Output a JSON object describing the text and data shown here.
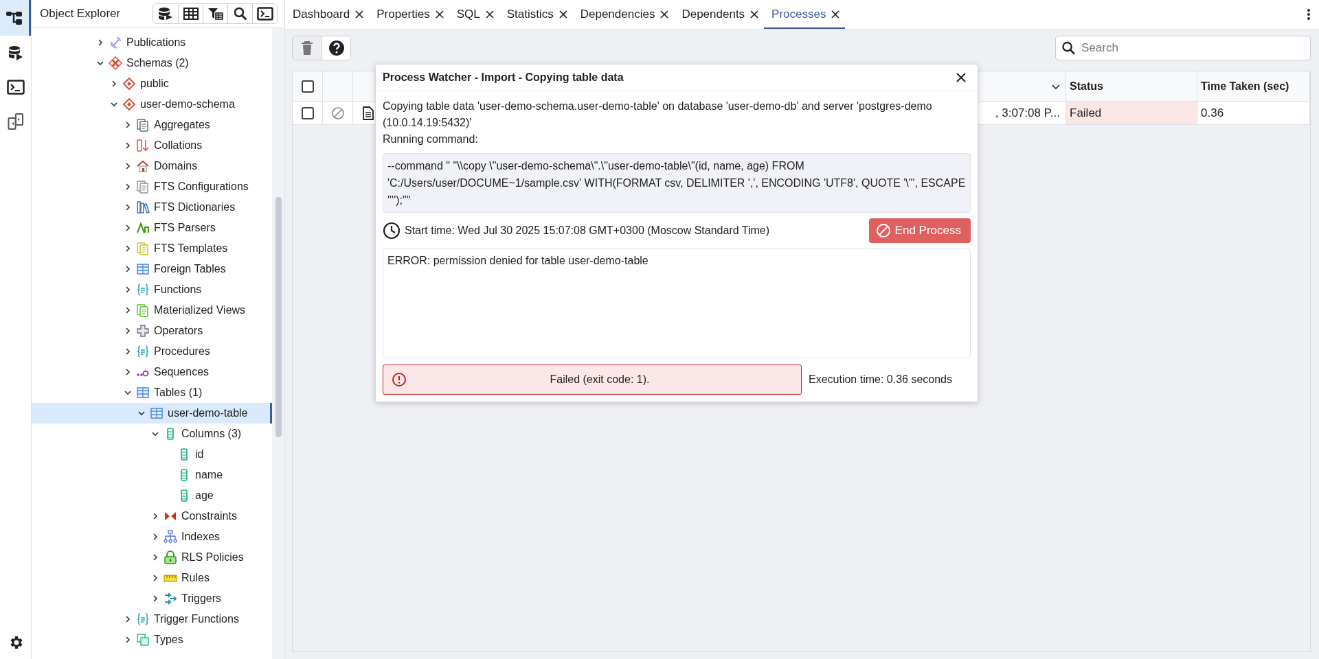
{
  "activity_bar": [
    {
      "kind": "explorer",
      "selected": true
    },
    {
      "kind": "query",
      "selected": false
    },
    {
      "kind": "terminal",
      "selected": false
    },
    {
      "kind": "compare",
      "selected": false
    }
  ],
  "explorer": {
    "title": "Object Explorer",
    "tree": [
      {
        "label": "Publications",
        "kind": "publications",
        "expanded": false,
        "selected": false
      },
      {
        "label": "Schemas (2)",
        "kind": "schemas",
        "expanded": true,
        "selected": false,
        "children": [
          {
            "label": "public",
            "kind": "schema",
            "expanded": false,
            "selected": false
          },
          {
            "label": "user-demo-schema",
            "kind": "schema",
            "expanded": true,
            "selected": false,
            "children": [
              {
                "label": "Aggregates",
                "kind": "aggregates",
                "expanded": false,
                "selected": false
              },
              {
                "label": "Collations",
                "kind": "collations",
                "expanded": false,
                "selected": false
              },
              {
                "label": "Domains",
                "kind": "domains",
                "expanded": false,
                "selected": false
              },
              {
                "label": "FTS Configurations",
                "kind": "fts_configurations",
                "expanded": false,
                "selected": false
              },
              {
                "label": "FTS Dictionaries",
                "kind": "fts_dictionaries",
                "expanded": false,
                "selected": false
              },
              {
                "label": "FTS Parsers",
                "kind": "fts_parsers",
                "expanded": false,
                "selected": false
              },
              {
                "label": "FTS Templates",
                "kind": "fts_templates",
                "expanded": false,
                "selected": false
              },
              {
                "label": "Foreign Tables",
                "kind": "foreign_tables",
                "expanded": false,
                "selected": false
              },
              {
                "label": "Functions",
                "kind": "functions",
                "expanded": false,
                "selected": false
              },
              {
                "label": "Materialized Views",
                "kind": "materialized_views",
                "expanded": false,
                "selected": false
              },
              {
                "label": "Operators",
                "kind": "operators",
                "expanded": false,
                "selected": false
              },
              {
                "label": "Procedures",
                "kind": "procedures",
                "expanded": false,
                "selected": false
              },
              {
                "label": "Sequences",
                "kind": "sequences",
                "expanded": false,
                "selected": false
              },
              {
                "label": "Tables (1)",
                "kind": "tables",
                "expanded": true,
                "selected": false,
                "children": [
                  {
                    "label": "user-demo-table",
                    "kind": "table",
                    "expanded": true,
                    "selected": true,
                    "children": [
                      {
                        "label": "Columns (3)",
                        "kind": "columns",
                        "expanded": true,
                        "selected": false,
                        "children": [
                          {
                            "label": "id",
                            "kind": "column",
                            "selected": false
                          },
                          {
                            "label": "name",
                            "kind": "column",
                            "selected": false
                          },
                          {
                            "label": "age",
                            "kind": "column",
                            "selected": false
                          }
                        ]
                      },
                      {
                        "label": "Constraints",
                        "kind": "constraints",
                        "expanded": false,
                        "selected": false
                      },
                      {
                        "label": "Indexes",
                        "kind": "indexes",
                        "expanded": false,
                        "selected": false
                      },
                      {
                        "label": "RLS Policies",
                        "kind": "rls_policies",
                        "expanded": false,
                        "selected": false
                      },
                      {
                        "label": "Rules",
                        "kind": "rules",
                        "expanded": false,
                        "selected": false
                      },
                      {
                        "label": "Triggers",
                        "kind": "triggers",
                        "expanded": false,
                        "selected": false
                      }
                    ]
                  }
                ]
              },
              {
                "label": "Trigger Functions",
                "kind": "trigger_functions",
                "expanded": false,
                "selected": false
              },
              {
                "label": "Types",
                "kind": "types",
                "expanded": false,
                "selected": false
              }
            ]
          }
        ]
      }
    ]
  },
  "tabs": [
    {
      "label": "Dashboard",
      "selected": false
    },
    {
      "label": "Properties",
      "selected": false
    },
    {
      "label": "SQL",
      "selected": false
    },
    {
      "label": "Statistics",
      "selected": false
    },
    {
      "label": "Dependencies",
      "selected": false
    },
    {
      "label": "Dependents",
      "selected": false
    },
    {
      "label": "Processes",
      "selected": true
    }
  ],
  "toolbar": {
    "delete_disabled": true,
    "search_placeholder": "Search"
  },
  "table": {
    "header_checked": false,
    "columns": [
      "Status",
      "Time Taken (sec)"
    ],
    "rows": [
      {
        "checked": false,
        "column_4": ", 3:07:08 P...",
        "status": "Failed",
        "failed": true,
        "time_taken": "0.36"
      }
    ]
  },
  "dialog": {
    "title": "Process Watcher - Import - Copying table data",
    "description": "Copying table data 'user-demo-schema.user-demo-table' on database 'user-demo-db' and server 'postgres-demo (10.0.14.19:5432)'",
    "command_label": "Running command:",
    "command": "--command \" \"\\\\copy \\\"user-demo-schema\\\".\\\"user-demo-table\\\"(id, name, age) FROM 'C:/Users/user/DOCUME~1/sample.csv' WITH(FORMAT csv, DELIMITER ',', ENCODING 'UTF8', QUOTE '\\\"', ESCAPE '''');\"\"",
    "start_time": "Start time: Wed Jul 30 2025 15:07:08 GMT+0300 (Moscow Standard Time)",
    "end_button": "End Process",
    "log": "ERROR: permission denied for table user-demo-table",
    "result": "Failed (exit code: 1).",
    "failed": true,
    "execution_time": "Execution time: 0.36 seconds"
  }
}
